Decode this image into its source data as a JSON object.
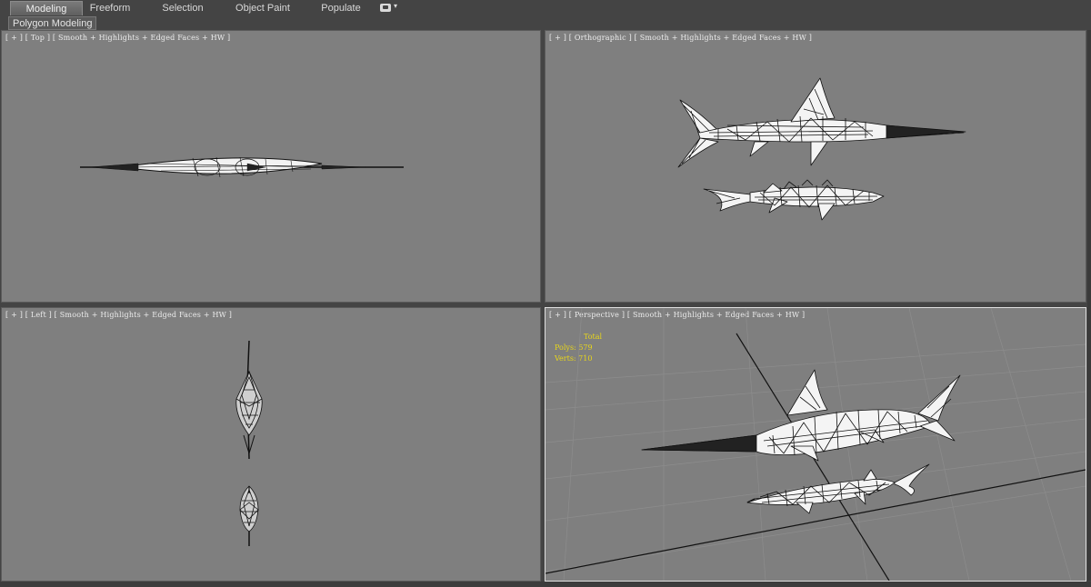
{
  "ribbon": {
    "tabs": [
      {
        "label": "Modeling",
        "active": true
      },
      {
        "label": "Freeform",
        "active": false
      },
      {
        "label": "Selection",
        "active": false
      },
      {
        "label": "Object Paint",
        "active": false
      },
      {
        "label": "Populate",
        "active": false
      }
    ],
    "toggle_icon": "display-toggle-icon",
    "panel_label": "Polygon Modeling"
  },
  "viewports": {
    "top": {
      "label": "[ + ] [ Top ] [ Smooth + Highlights + Edged Faces + HW ]"
    },
    "front": {
      "label": "[ + ] [ Orthographic ] [ Smooth + Highlights + Edged Faces + HW ]"
    },
    "left": {
      "label": "[ + ] [ Left ] [ Smooth + Highlights + Edged Faces + HW ]"
    },
    "perspective": {
      "label": "[ + ] [ Perspective ] [ Smooth + Highlights + Edged Faces + HW ]",
      "stats": {
        "title": "Total",
        "polys_label": "Polys:",
        "polys": "579",
        "verts_label": "Verts:",
        "verts": "710"
      }
    }
  },
  "colors": {
    "viewport_bg": "#7f7f7f",
    "ui_bg": "#444444",
    "stats_text": "#e8d61a",
    "mesh_fill": "#f4f4f4",
    "wire": "#111111"
  }
}
